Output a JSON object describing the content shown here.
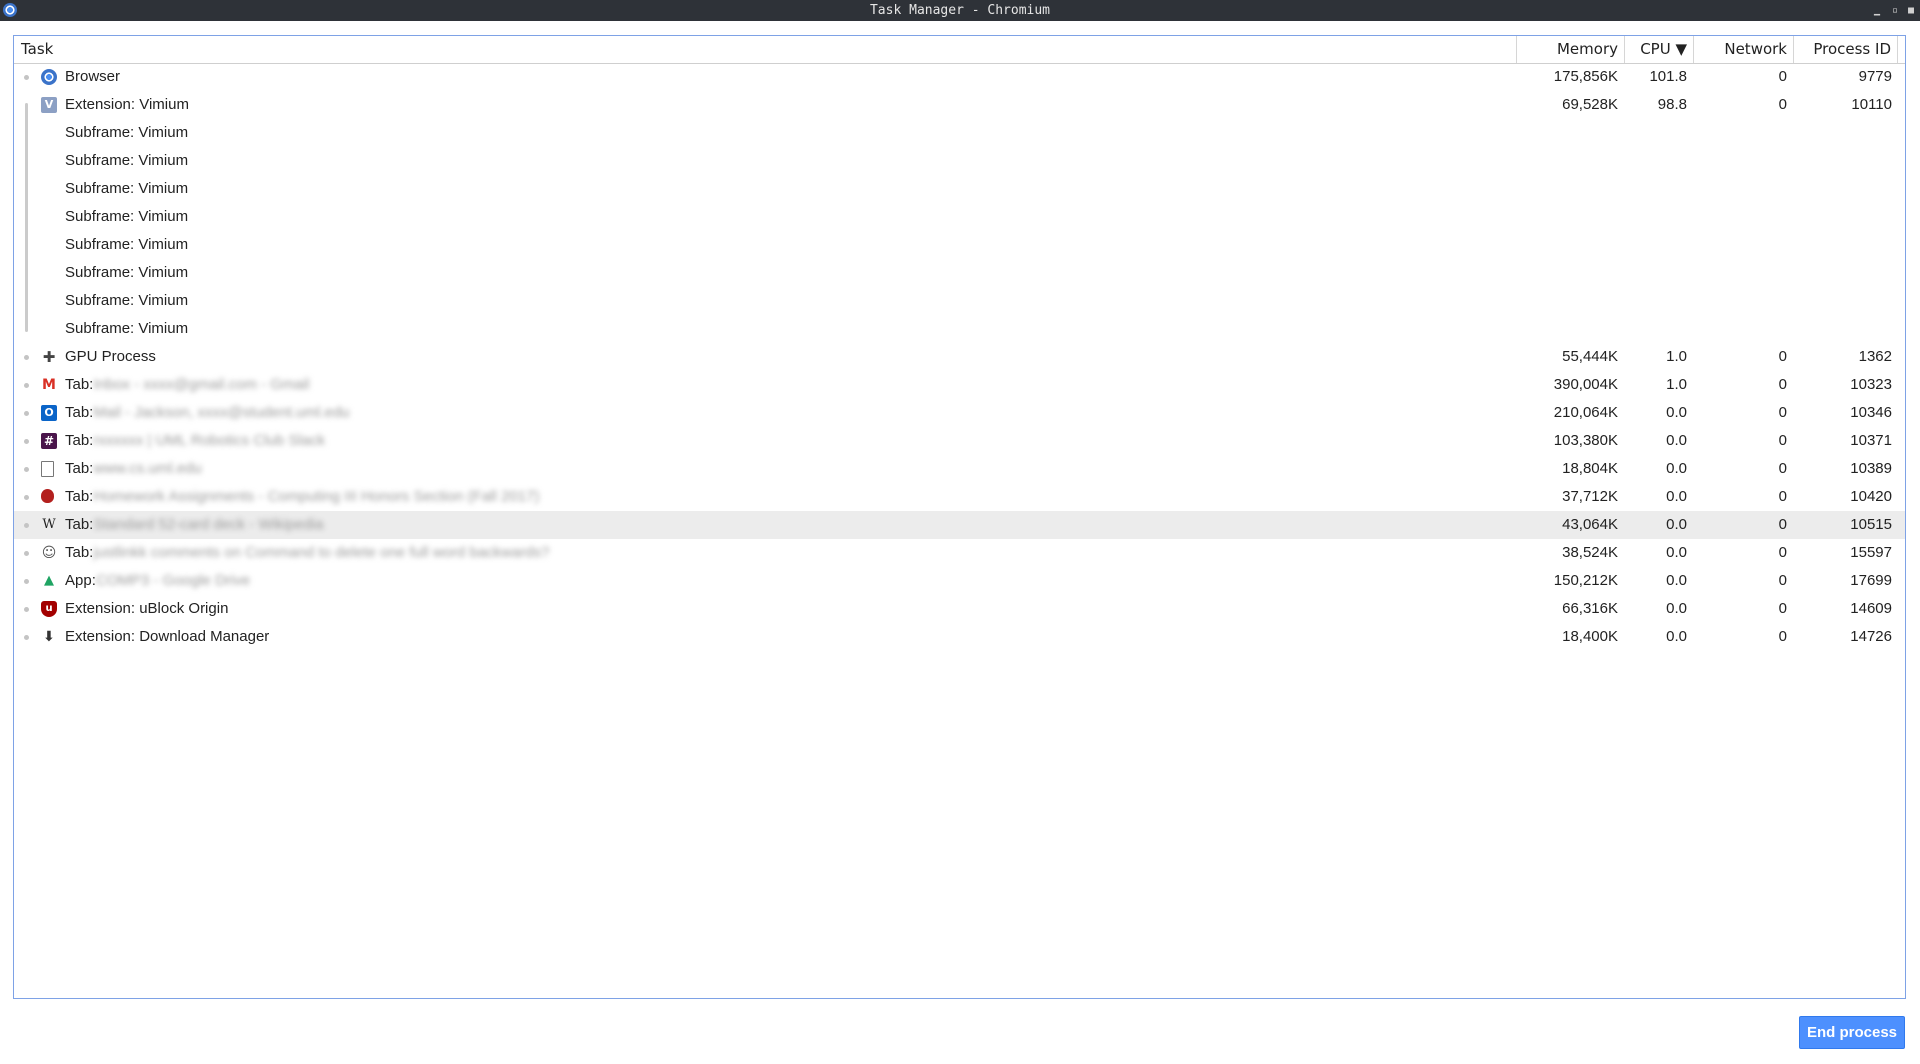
{
  "window": {
    "title": "Task Manager - Chromium",
    "controls": {
      "minimize": "▁",
      "maximize": "▫",
      "close": "■"
    }
  },
  "columns": {
    "task": "Task",
    "memory": "Memory",
    "cpu": "CPU ▼",
    "network": "Network",
    "pid": "Process ID"
  },
  "rows": [
    {
      "prefix": "Browser",
      "detail": "",
      "memory": "175,856K",
      "cpu": "101.8",
      "network": "0",
      "pid": "9779",
      "icon": "chromium-icon",
      "bullet": true
    },
    {
      "prefix": "Extension: Vimium",
      "detail": "",
      "memory": "69,528K",
      "cpu": "98.8",
      "network": "0",
      "pid": "10110",
      "icon": "vimium-icon",
      "bullet": false
    },
    {
      "prefix": "Subframe: Vimium",
      "detail": "",
      "memory": "",
      "cpu": "",
      "network": "",
      "pid": "",
      "icon": "",
      "bullet": false
    },
    {
      "prefix": "Subframe: Vimium",
      "detail": "",
      "memory": "",
      "cpu": "",
      "network": "",
      "pid": "",
      "icon": "",
      "bullet": false
    },
    {
      "prefix": "Subframe: Vimium",
      "detail": "",
      "memory": "",
      "cpu": "",
      "network": "",
      "pid": "",
      "icon": "",
      "bullet": false
    },
    {
      "prefix": "Subframe: Vimium",
      "detail": "",
      "memory": "",
      "cpu": "",
      "network": "",
      "pid": "",
      "icon": "",
      "bullet": false
    },
    {
      "prefix": "Subframe: Vimium",
      "detail": "",
      "memory": "",
      "cpu": "",
      "network": "",
      "pid": "",
      "icon": "",
      "bullet": false
    },
    {
      "prefix": "Subframe: Vimium",
      "detail": "",
      "memory": "",
      "cpu": "",
      "network": "",
      "pid": "",
      "icon": "",
      "bullet": false
    },
    {
      "prefix": "Subframe: Vimium",
      "detail": "",
      "memory": "",
      "cpu": "",
      "network": "",
      "pid": "",
      "icon": "",
      "bullet": false
    },
    {
      "prefix": "Subframe: Vimium",
      "detail": "",
      "memory": "",
      "cpu": "",
      "network": "",
      "pid": "",
      "icon": "",
      "bullet": false
    },
    {
      "prefix": "GPU Process",
      "detail": "",
      "memory": "55,444K",
      "cpu": "1.0",
      "network": "0",
      "pid": "1362",
      "icon": "puzzle-icon",
      "bullet": true
    },
    {
      "prefix": "Tab:",
      "detail": "Inbox - xxxx@gmail.com - Gmail",
      "memory": "390,004K",
      "cpu": "1.0",
      "network": "0",
      "pid": "10323",
      "icon": "gmail-icon",
      "bullet": true
    },
    {
      "prefix": "Tab:",
      "detail": "Mail - Jackson, xxxx@student.uml.edu",
      "memory": "210,064K",
      "cpu": "0.0",
      "network": "0",
      "pid": "10346",
      "icon": "outlook-icon",
      "bullet": true
    },
    {
      "prefix": "Tab:",
      "detail": "rxxxxxx | UML Robotics Club Slack",
      "memory": "103,380K",
      "cpu": "0.0",
      "network": "0",
      "pid": "10371",
      "icon": "slack-icon",
      "bullet": true
    },
    {
      "prefix": "Tab:",
      "detail": "www.cs.uml.edu",
      "memory": "18,804K",
      "cpu": "0.0",
      "network": "0",
      "pid": "10389",
      "icon": "page-icon",
      "bullet": true
    },
    {
      "prefix": "Tab:",
      "detail": "Homework Assignments - Computing III Honors Section (Fall 2017)",
      "memory": "37,712K",
      "cpu": "0.0",
      "network": "0",
      "pid": "10420",
      "icon": "shield-red-icon",
      "bullet": true
    },
    {
      "prefix": "Tab:",
      "detail": "Standard 52-card deck - Wikipedia",
      "memory": "43,064K",
      "cpu": "0.0",
      "network": "0",
      "pid": "10515",
      "icon": "wikipedia-icon",
      "bullet": true,
      "selected": true
    },
    {
      "prefix": "Tab:",
      "detail": "justlinkk comments on Command to delete one full word backwards?",
      "memory": "38,524K",
      "cpu": "0.0",
      "network": "0",
      "pid": "15597",
      "icon": "reddit-icon",
      "bullet": true
    },
    {
      "prefix": "App:",
      "detail": "COMP3 - Google Drive",
      "memory": "150,212K",
      "cpu": "0.0",
      "network": "0",
      "pid": "17699",
      "icon": "drive-icon",
      "bullet": true
    },
    {
      "prefix": "Extension: uBlock Origin",
      "detail": "",
      "memory": "66,316K",
      "cpu": "0.0",
      "network": "0",
      "pid": "14609",
      "icon": "ublock-icon",
      "bullet": true
    },
    {
      "prefix": "Extension: Download Manager",
      "detail": "",
      "memory": "18,400K",
      "cpu": "0.0",
      "network": "0",
      "pid": "14726",
      "icon": "download-icon",
      "bullet": true
    }
  ],
  "buttons": {
    "end_process": "End process"
  },
  "colors": {
    "accent": "#4d90fe",
    "titlebar": "#2e3238",
    "selected_row": "#ececec"
  }
}
